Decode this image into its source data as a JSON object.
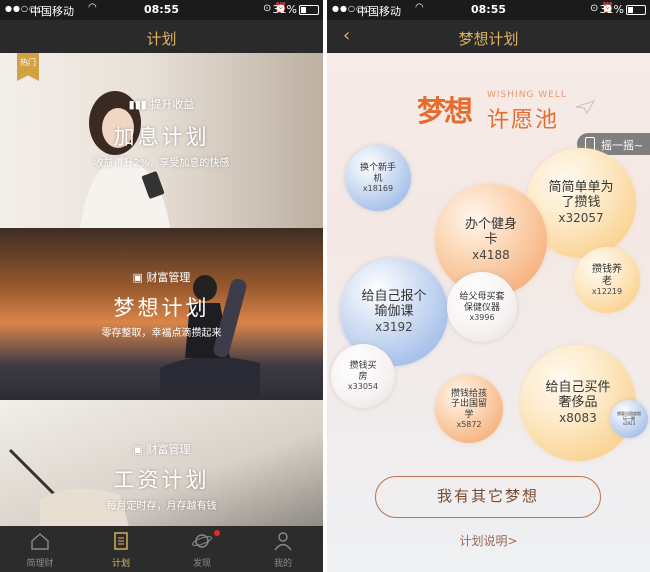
{
  "status": {
    "carrier": "中国移动",
    "time": "08:55",
    "battery": "31%",
    "signal": "●●○○○"
  },
  "left": {
    "title": "计划",
    "hot_badge": "热门",
    "plans": [
      {
        "tag": "提升收益",
        "name": "加息计划",
        "desc": "收益再升2%，享受加息的快感"
      },
      {
        "tag": "财富管理",
        "name": "梦想计划",
        "desc": "零存整取，幸福点滴攒起来"
      },
      {
        "tag": "财富管理",
        "name": "工资计划",
        "desc": "每月定时存，月存越有钱"
      }
    ],
    "tabs": [
      "简理财",
      "计划",
      "发现",
      "我的"
    ]
  },
  "right": {
    "title": "梦想计划",
    "logo_main": "梦想",
    "logo_sub": "许愿池",
    "logo_en": "WISHING WELL",
    "shake": "摇一摇~",
    "bubbles": [
      {
        "text": "换个新手机",
        "count": "x18169"
      },
      {
        "text": "简简单单为了攒钱",
        "count": "x32057"
      },
      {
        "text": "办个健身卡",
        "count": "x4188"
      },
      {
        "text": "攒钱养老",
        "count": "x12219"
      },
      {
        "text": "给自己报个瑜伽课",
        "count": "x3192"
      },
      {
        "text": "给父母买套保健仪器",
        "count": "x3996"
      },
      {
        "text": "攒钱买房",
        "count": "x33054"
      },
      {
        "text": "攒钱给孩子出国留学",
        "count": "x5872"
      },
      {
        "text": "给自己买件奢侈品",
        "count": "x8083"
      },
      {
        "text": "想要出国度假玩一圈",
        "count": "x2913"
      }
    ],
    "dream_button": "我有其它梦想",
    "explain_link": "计划说明>"
  }
}
